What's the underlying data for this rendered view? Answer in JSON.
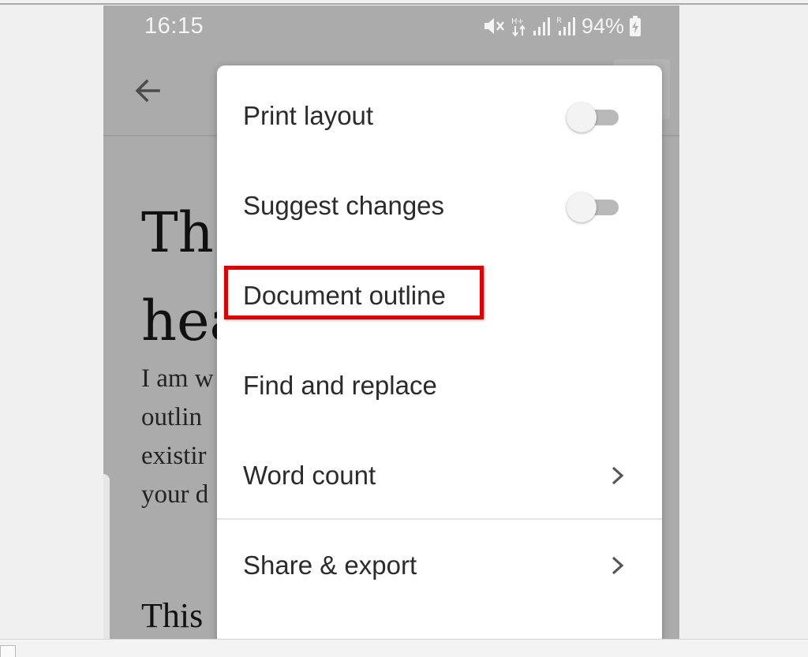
{
  "status_bar": {
    "time": "16:15",
    "battery_percent": "94%"
  },
  "document": {
    "heading_fragment": "Th\nhea",
    "paragraph_fragment": "I am w\noutlin\nexistir\nyour d",
    "second_heading_fragment": "This"
  },
  "menu": {
    "items": [
      {
        "label": "Print layout",
        "control": "toggle",
        "on": false
      },
      {
        "label": "Suggest changes",
        "control": "toggle",
        "on": false
      },
      {
        "label": "Document outline",
        "control": "none",
        "highlighted": true
      },
      {
        "label": "Find and replace",
        "control": "none"
      },
      {
        "label": "Word count",
        "control": "chevron-right-icon"
      },
      {
        "label": "Share & export",
        "control": "chevron-right-icon"
      }
    ]
  },
  "colors": {
    "highlight": "#e10000",
    "scrim": "#ababab",
    "menu_background": "#ffffff"
  }
}
